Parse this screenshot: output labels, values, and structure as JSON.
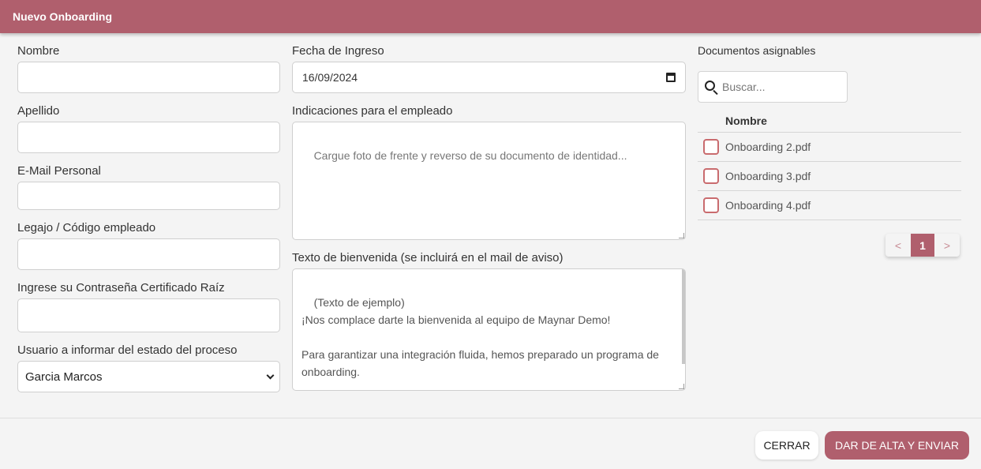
{
  "header": {
    "title": "Nuevo Onboarding"
  },
  "form": {
    "nombre_label": "Nombre",
    "nombre_value": "",
    "apellido_label": "Apellido",
    "apellido_value": "",
    "email_label": "E-Mail Personal",
    "email_value": "",
    "legajo_label": "Legajo / Código empleado",
    "legajo_value": "",
    "password_label": "Ingrese su Contraseña Certificado Raíz",
    "password_value": "",
    "usuario_label": "Usuario a informar del estado del proceso",
    "usuario_value": "Garcia Marcos",
    "fecha_label": "Fecha de Ingreso",
    "fecha_value": "16/09/2024",
    "indicaciones_label": "Indicaciones para el empleado",
    "indicaciones_placeholder": "Cargue foto de frente y reverso de su documento de identidad...",
    "bienvenida_label": "Texto de bienvenida (se incluirá en el mail de aviso)",
    "bienvenida_value": "(Texto de ejemplo)\n¡Nos complace darte la bienvenida al equipo de Maynar Demo!\n\nPara garantizar una integración fluida, hemos preparado un programa de onboarding.\n\nEstamos emocionados por verte crecer y prosperar en nuestra"
  },
  "documents": {
    "title": "Documentos asignables",
    "search_placeholder": "Buscar...",
    "column_header": "Nombre",
    "rows": [
      {
        "name": "Onboarding 2.pdf",
        "checked": false
      },
      {
        "name": "Onboarding 3.pdf",
        "checked": false
      },
      {
        "name": "Onboarding 4.pdf",
        "checked": false
      }
    ],
    "pagination": {
      "prev": "<",
      "current": "1",
      "next": ">"
    }
  },
  "footer": {
    "close_label": "CERRAR",
    "submit_label": "DAR DE ALTA Y ENVIAR"
  },
  "colors": {
    "accent": "#b05f6d",
    "checkbox_border": "#c96b6e",
    "background": "#f4f4f4"
  }
}
